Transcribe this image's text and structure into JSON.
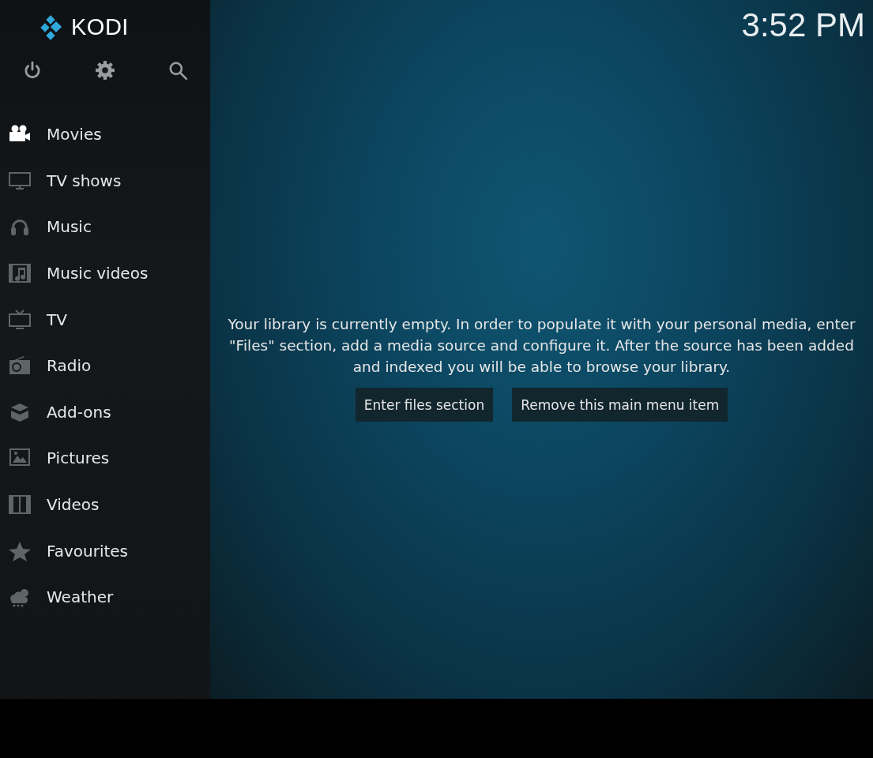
{
  "logo": {
    "text": "KODI"
  },
  "clock": "3:52 PM",
  "top_buttons": [
    {
      "kind": "power"
    },
    {
      "kind": "settings"
    },
    {
      "kind": "search"
    }
  ],
  "menu": [
    {
      "kind": "movies",
      "label": "Movies",
      "selected": true
    },
    {
      "kind": "tvshows",
      "label": "TV shows",
      "selected": false
    },
    {
      "kind": "music",
      "label": "Music",
      "selected": false
    },
    {
      "kind": "musicvideos",
      "label": "Music videos",
      "selected": false
    },
    {
      "kind": "tv",
      "label": "TV",
      "selected": false
    },
    {
      "kind": "radio",
      "label": "Radio",
      "selected": false
    },
    {
      "kind": "addons",
      "label": "Add-ons",
      "selected": false
    },
    {
      "kind": "pictures",
      "label": "Pictures",
      "selected": false
    },
    {
      "kind": "videos",
      "label": "Videos",
      "selected": false
    },
    {
      "kind": "favourites",
      "label": "Favourites",
      "selected": false
    },
    {
      "kind": "weather",
      "label": "Weather",
      "selected": false
    }
  ],
  "message": "Your library is currently empty. In order to populate it with your personal media, enter \"Files\" section, add a media source and configure it. After the source has been added and indexed you will be able to browse your library.",
  "buttons": [
    "Enter files section",
    "Remove this main menu item"
  ]
}
